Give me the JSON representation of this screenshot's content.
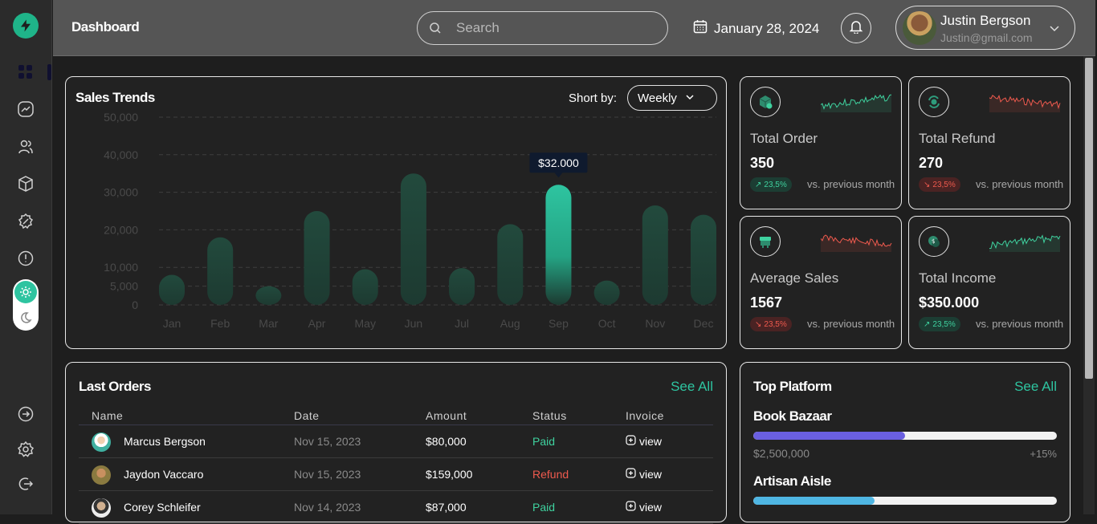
{
  "header": {
    "title": "Dashboard",
    "search_placeholder": "Search",
    "date": "January 28, 2024",
    "user_name": "Justin Bergson",
    "user_email": "Justin@gmail.com"
  },
  "sidebar": {
    "icons": [
      "dashboard-icon",
      "analytics-icon",
      "users-icon",
      "box-icon",
      "discount-icon",
      "info-icon",
      "login-icon",
      "settings-icon",
      "logout-icon"
    ],
    "active": "dashboard-icon"
  },
  "sales": {
    "title": "Sales Trends",
    "sort_label": "Short by:",
    "sort_value": "Weekly",
    "tooltip": "$32.000"
  },
  "chart_data": {
    "type": "bar",
    "title": "Sales Trends",
    "categories": [
      "Jan",
      "Feb",
      "Mar",
      "Apr",
      "May",
      "Jun",
      "Jul",
      "Aug",
      "Sep",
      "Oct",
      "Nov",
      "Dec"
    ],
    "values": [
      8000,
      18000,
      5000,
      25000,
      9500,
      35000,
      9800,
      21500,
      32000,
      6500,
      26500,
      24000
    ],
    "ylim": [
      0,
      50000
    ],
    "yticks": [
      "0",
      "5,000",
      "10,000",
      "20,000",
      "30,000",
      "40,000",
      "50,000"
    ],
    "highlight_index": 8,
    "grid": "dashed horizontal",
    "colors": {
      "bar": "#1f4a3c",
      "highlight": "#2ec4a0"
    }
  },
  "stats": [
    {
      "label": "Total Order",
      "value": "350",
      "badge": "23,5%",
      "trend": "up",
      "vs": "vs. previous month",
      "icon": "box-check-icon"
    },
    {
      "label": "Total Refund",
      "value": "270",
      "badge": "23,5%",
      "trend": "down",
      "vs": "vs. previous month",
      "icon": "refund-icon"
    },
    {
      "label": "Average Sales",
      "value": "1567",
      "badge": "23,5%",
      "trend": "down",
      "vs": "vs. previous month",
      "icon": "store-icon"
    },
    {
      "label": "Total Income",
      "value": "$350.000",
      "badge": "23,5%",
      "trend": "up",
      "vs": "vs. previous month",
      "icon": "coins-icon"
    }
  ],
  "orders": {
    "title": "Last Orders",
    "see_all": "See All",
    "columns": [
      "Name",
      "Date",
      "Amount",
      "Status",
      "Invoice"
    ],
    "rows": [
      {
        "name": "Marcus Bergson",
        "date": "Nov 15, 2023",
        "amount": "$80,000",
        "status": "Paid",
        "invoice": "view"
      },
      {
        "name": "Jaydon Vaccaro",
        "date": "Nov 15, 2023",
        "amount": "$159,000",
        "status": "Refund",
        "invoice": "view"
      },
      {
        "name": "Corey Schleifer",
        "date": "Nov 14, 2023",
        "amount": "$87,000",
        "status": "Paid",
        "invoice": "view"
      }
    ]
  },
  "platform": {
    "title": "Top Platform",
    "see_all": "See All",
    "items": [
      {
        "name": "Book Bazaar",
        "amount": "$2,500,000",
        "pct": "+15%",
        "progress": 0.5,
        "color": "#6a5fe0"
      },
      {
        "name": "Artisan Aisle",
        "progress": 0.4,
        "color": "#4fb6e3"
      }
    ]
  },
  "colors": {
    "accent": "#2ec4a0",
    "up": "#3fd29f",
    "down": "#ef5a4e"
  }
}
